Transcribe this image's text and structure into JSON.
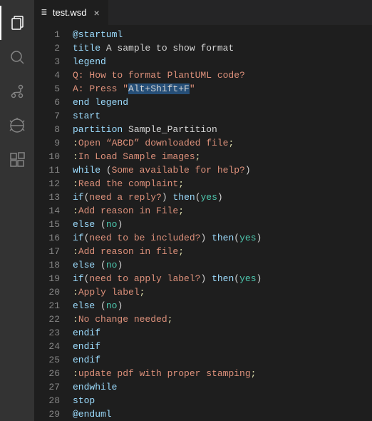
{
  "activity_bar": {
    "items": [
      {
        "name": "explorer-icon",
        "active": true
      },
      {
        "name": "search-icon",
        "active": false
      },
      {
        "name": "source-control-icon",
        "active": false
      },
      {
        "name": "debug-icon",
        "active": false
      },
      {
        "name": "extensions-icon",
        "active": false
      }
    ]
  },
  "tab": {
    "filename": "test.wsd",
    "icon_glyph": "≣",
    "close_glyph": "×"
  },
  "code": {
    "lines": [
      [
        {
          "t": "@startuml",
          "c": "keyword"
        }
      ],
      [
        {
          "t": "title",
          "c": "keyword"
        },
        {
          "t": " A sample to show format",
          "c": "plain"
        }
      ],
      [
        {
          "t": "legend",
          "c": "keyword"
        }
      ],
      [
        {
          "t": "Q: How to format PlantUML code?",
          "c": "string"
        }
      ],
      [
        {
          "t": "A: Press \"",
          "c": "string"
        },
        {
          "t": "Alt+Shift+F",
          "c": "highlight"
        },
        {
          "t": "\"",
          "c": "string"
        }
      ],
      [
        {
          "t": "end legend",
          "c": "keyword"
        }
      ],
      [
        {
          "t": "start",
          "c": "keyword"
        }
      ],
      [
        {
          "t": "partition",
          "c": "keyword"
        },
        {
          "t": " Sample_Partition",
          "c": "plain"
        }
      ],
      [
        {
          "t": ":",
          "c": "punct"
        },
        {
          "t": "Open “ABCD” downloaded file",
          "c": "string"
        },
        {
          "t": ";",
          "c": "punct"
        }
      ],
      [
        {
          "t": ":",
          "c": "punct"
        },
        {
          "t": "In Load Sample images",
          "c": "string"
        },
        {
          "t": ";",
          "c": "punct"
        }
      ],
      [
        {
          "t": "while",
          "c": "keyword"
        },
        {
          "t": " (",
          "c": "paren"
        },
        {
          "t": "Some available for help?",
          "c": "string"
        },
        {
          "t": ")",
          "c": "paren"
        }
      ],
      [
        {
          "t": ":",
          "c": "punct"
        },
        {
          "t": "Read the complaint",
          "c": "string"
        },
        {
          "t": ";",
          "c": "punct"
        }
      ],
      [
        {
          "t": "if",
          "c": "keyword"
        },
        {
          "t": "(",
          "c": "paren"
        },
        {
          "t": "need a reply?",
          "c": "string"
        },
        {
          "t": ")",
          "c": "paren"
        },
        {
          "t": " ",
          "c": "plain"
        },
        {
          "t": "then",
          "c": "keyword"
        },
        {
          "t": "(",
          "c": "paren"
        },
        {
          "t": "yes",
          "c": "value"
        },
        {
          "t": ")",
          "c": "paren"
        }
      ],
      [
        {
          "t": ":",
          "c": "punct"
        },
        {
          "t": "Add reason in File",
          "c": "string"
        },
        {
          "t": ";",
          "c": "punct"
        }
      ],
      [
        {
          "t": "else",
          "c": "keyword"
        },
        {
          "t": " (",
          "c": "paren"
        },
        {
          "t": "no",
          "c": "value"
        },
        {
          "t": ")",
          "c": "paren"
        }
      ],
      [
        {
          "t": "if",
          "c": "keyword"
        },
        {
          "t": "(",
          "c": "paren"
        },
        {
          "t": "need to be included?",
          "c": "string"
        },
        {
          "t": ")",
          "c": "paren"
        },
        {
          "t": " ",
          "c": "plain"
        },
        {
          "t": "then",
          "c": "keyword"
        },
        {
          "t": "(",
          "c": "paren"
        },
        {
          "t": "yes",
          "c": "value"
        },
        {
          "t": ")",
          "c": "paren"
        }
      ],
      [
        {
          "t": ":",
          "c": "punct"
        },
        {
          "t": "Add reason in file",
          "c": "string"
        },
        {
          "t": ";",
          "c": "punct"
        }
      ],
      [
        {
          "t": "else",
          "c": "keyword"
        },
        {
          "t": " (",
          "c": "paren"
        },
        {
          "t": "no",
          "c": "value"
        },
        {
          "t": ")",
          "c": "paren"
        }
      ],
      [
        {
          "t": "if",
          "c": "keyword"
        },
        {
          "t": "(",
          "c": "paren"
        },
        {
          "t": "need to apply label?",
          "c": "string"
        },
        {
          "t": ")",
          "c": "paren"
        },
        {
          "t": " ",
          "c": "plain"
        },
        {
          "t": "then",
          "c": "keyword"
        },
        {
          "t": "(",
          "c": "paren"
        },
        {
          "t": "yes",
          "c": "value"
        },
        {
          "t": ")",
          "c": "paren"
        }
      ],
      [
        {
          "t": ":",
          "c": "punct"
        },
        {
          "t": "Apply label",
          "c": "string"
        },
        {
          "t": ";",
          "c": "punct"
        }
      ],
      [
        {
          "t": "else",
          "c": "keyword"
        },
        {
          "t": " (",
          "c": "paren"
        },
        {
          "t": "no",
          "c": "value"
        },
        {
          "t": ")",
          "c": "paren"
        }
      ],
      [
        {
          "t": ":",
          "c": "punct"
        },
        {
          "t": "No change needed",
          "c": "string"
        },
        {
          "t": ";",
          "c": "punct"
        }
      ],
      [
        {
          "t": "endif",
          "c": "keyword"
        }
      ],
      [
        {
          "t": "endif",
          "c": "keyword"
        }
      ],
      [
        {
          "t": "endif",
          "c": "keyword"
        }
      ],
      [
        {
          "t": ":",
          "c": "punct"
        },
        {
          "t": "update pdf with proper stamping",
          "c": "string"
        },
        {
          "t": ";",
          "c": "punct"
        }
      ],
      [
        {
          "t": "endwhile",
          "c": "keyword"
        }
      ],
      [
        {
          "t": "stop",
          "c": "keyword"
        }
      ],
      [
        {
          "t": "@enduml",
          "c": "keyword"
        }
      ]
    ]
  }
}
